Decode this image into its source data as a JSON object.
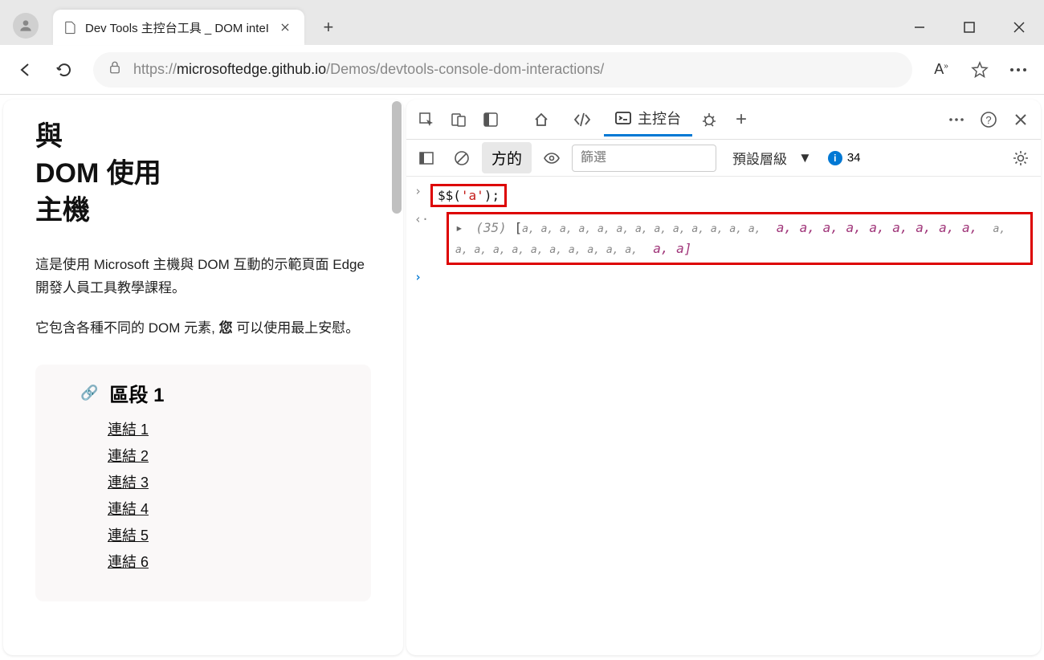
{
  "window": {
    "tab_title": "Dev Tools 主控台工具 _ DOM inteI"
  },
  "toolbar": {
    "url_prefix": "https://",
    "url_host": "microsoftedge.github.io",
    "url_path": "/Demos/devtools-console-dom-interactions/"
  },
  "page": {
    "heading_l1": "與",
    "heading_l2": "DOM 使用",
    "heading_l3": "主機",
    "para1": "這是使用 Microsoft 主機與 DOM 互動的示範頁面 Edge 開發人員工具教學課程。",
    "para2_a": "它包含各種不同的 DOM 元素, ",
    "para2_b": "您",
    "para2_c": " 可以使用最上安慰。",
    "section_title": "區段 1",
    "links": [
      "連結 1",
      "連結 2",
      "連結 3",
      "連結 4",
      "連結 5",
      "連結 6"
    ]
  },
  "devtools": {
    "tab_console": "主控台",
    "filter_label": "方的",
    "filter_placeholder": "篩選",
    "level_label": "預設層級",
    "issues_count": "34",
    "cmd_prefix": "$$(",
    "cmd_str": "'a'",
    "cmd_suffix": ");",
    "result_count": "(35)",
    "array_open": "[",
    "array_items_line1": "a,  a,  a,  a,  a,  a,  a,  a,  a, a,  a,  a,  a,",
    "array_items_highlight1": "a,  a,  a,  a,  a,  a,",
    "array_items_highlight2": "a,  a,  a,",
    "array_items_line2b": "a,  a,  a, a,  a,  a,  a,  a, a,  a,  a,",
    "array_items_highlight3": "a,  a",
    "array_close": "]"
  }
}
